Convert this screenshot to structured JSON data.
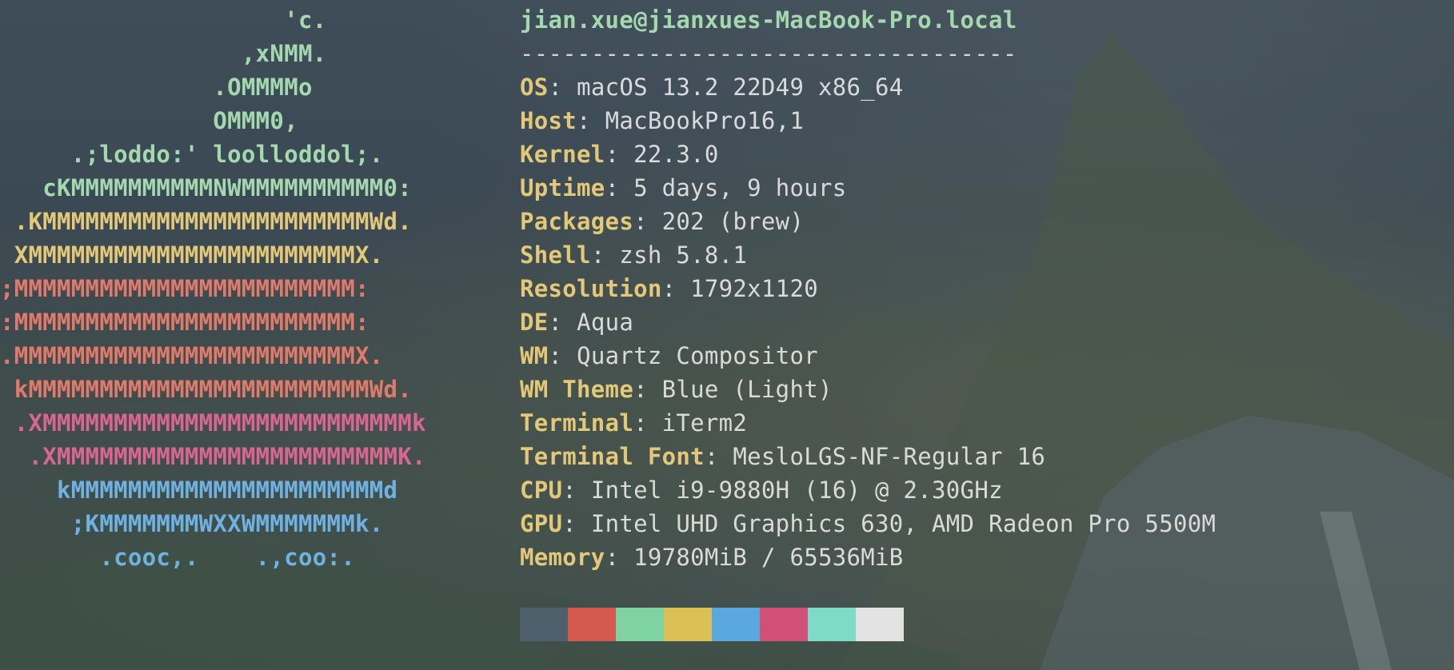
{
  "logo": {
    "lines": [
      {
        "text": "                    'c.",
        "color": "#a4d8ae"
      },
      {
        "text": "                 ,xNMM.",
        "color": "#a4d8ae"
      },
      {
        "text": "               .OMMMMo",
        "color": "#a4d8ae"
      },
      {
        "text": "               OMMM0,",
        "color": "#a4d8ae"
      },
      {
        "text": "     .;loddo:' loolloddol;.",
        "color": "#a4d8ae"
      },
      {
        "text": "   cKMMMMMMMMMMNWMMMMMMMMMM0:",
        "color": "#a4d8ae"
      },
      {
        "text": " .KMMMMMMMMMMMMMMMMMMMMMMMWd.",
        "color": "#e2c878"
      },
      {
        "text": " XMMMMMMMMMMMMMMMMMMMMMMMX.",
        "color": "#e2c878"
      },
      {
        "text": ";MMMMMMMMMMMMMMMMMMMMMMMM:",
        "color": "#e07a6b"
      },
      {
        "text": ":MMMMMMMMMMMMMMMMMMMMMMMM:",
        "color": "#e07a6b"
      },
      {
        "text": ".MMMMMMMMMMMMMMMMMMMMMMMMX.",
        "color": "#e07a6b"
      },
      {
        "text": " kMMMMMMMMMMMMMMMMMMMMMMMMWd.",
        "color": "#e07a6b"
      },
      {
        "text": " .XMMMMMMMMMMMMMMMMMMMMMMMMMMk",
        "color": "#d9668e"
      },
      {
        "text": "  .XMMMMMMMMMMMMMMMMMMMMMMMMK.",
        "color": "#d9668e"
      },
      {
        "text": "    kMMMMMMMMMMMMMMMMMMMMMMd",
        "color": "#6fb2e2"
      },
      {
        "text": "     ;KMMMMMMMWXXWMMMMMMMk.",
        "color": "#6fb2e2"
      },
      {
        "text": "       .cooc,.    .,coo:.",
        "color": "#6fb2e2"
      }
    ]
  },
  "header": {
    "title": "jian.xue@jianxues-MacBook-Pro.local",
    "separator": "-----------------------------------"
  },
  "info": [
    {
      "key": "OS",
      "value": "macOS 13.2 22D49 x86_64"
    },
    {
      "key": "Host",
      "value": "MacBookPro16,1"
    },
    {
      "key": "Kernel",
      "value": "22.3.0"
    },
    {
      "key": "Uptime",
      "value": "5 days, 9 hours"
    },
    {
      "key": "Packages",
      "value": "202 (brew)"
    },
    {
      "key": "Shell",
      "value": "zsh 5.8.1"
    },
    {
      "key": "Resolution",
      "value": "1792x1120"
    },
    {
      "key": "DE",
      "value": "Aqua"
    },
    {
      "key": "WM",
      "value": "Quartz Compositor"
    },
    {
      "key": "WM Theme",
      "value": "Blue (Light)"
    },
    {
      "key": "Terminal",
      "value": "iTerm2"
    },
    {
      "key": "Terminal Font",
      "value": "MesloLGS-NF-Regular 16"
    },
    {
      "key": "CPU",
      "value": "Intel i9-9880H (16) @ 2.30GHz"
    },
    {
      "key": "GPU",
      "value": "Intel UHD Graphics 630, AMD Radeon Pro 5500M"
    },
    {
      "key": "Memory",
      "value": "19780MiB / 65536MiB"
    }
  ],
  "palette": [
    "#4f606c",
    "#d45a50",
    "#7ed3a0",
    "#dbc055",
    "#5aa8de",
    "#d1507a",
    "#7edbc6",
    "#e3e3e3"
  ]
}
